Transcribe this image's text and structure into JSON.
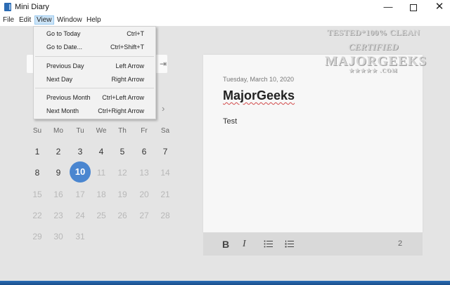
{
  "window": {
    "title": "Mini Diary",
    "controls": [
      "—",
      "☐",
      "✕"
    ]
  },
  "menubar": [
    "File",
    "Edit",
    "View",
    "Window",
    "Help"
  ],
  "view_menu": {
    "items": [
      {
        "label": "Go to Today",
        "accel": "Ctrl+T"
      },
      {
        "label": "Go to Date...",
        "accel": "Ctrl+Shift+T"
      },
      {
        "label": "Previous Day",
        "accel": "Left Arrow"
      },
      {
        "label": "Next Day",
        "accel": "Right Arrow"
      },
      {
        "label": "Previous Month",
        "accel": "Ctrl+Left Arrow"
      },
      {
        "label": "Next Month",
        "accel": "Ctrl+Right Arrow"
      }
    ]
  },
  "calendar": {
    "weekdays": [
      "Su",
      "Mo",
      "Tu",
      "We",
      "Th",
      "Fr",
      "Sa"
    ],
    "selected_day": "10",
    "days": [
      "1",
      "2",
      "3",
      "4",
      "5",
      "6",
      "7",
      "8",
      "9",
      "10",
      "11",
      "12",
      "13",
      "14",
      "15",
      "16",
      "17",
      "18",
      "19",
      "20",
      "21",
      "22",
      "23",
      "24",
      "25",
      "26",
      "27",
      "28",
      "29",
      "30",
      "31"
    ],
    "next_month_icon": "chevron-right-icon",
    "collapse_icon": "collapse-sidebar-icon"
  },
  "entry": {
    "date": "Tuesday, March 10, 2020",
    "title": "MajorGeeks",
    "body": "Test"
  },
  "toolbar": {
    "bold": "B",
    "italic": "I",
    "bullet_list_icon": "bullet-list-icon",
    "numbered_list_icon": "numbered-list-icon",
    "word_count": "2"
  },
  "watermark": {
    "line1": "TESTED*100% CLEAN",
    "line2": "CERTIFIED",
    "line3": "MAJORGEEKS",
    "line4": "★★★★★ .COM"
  },
  "colors": {
    "accent": "#4a86d0",
    "background": "#e4e4e4",
    "editor": "#f7f7f7",
    "bottom_bar": "#2a6db5"
  }
}
